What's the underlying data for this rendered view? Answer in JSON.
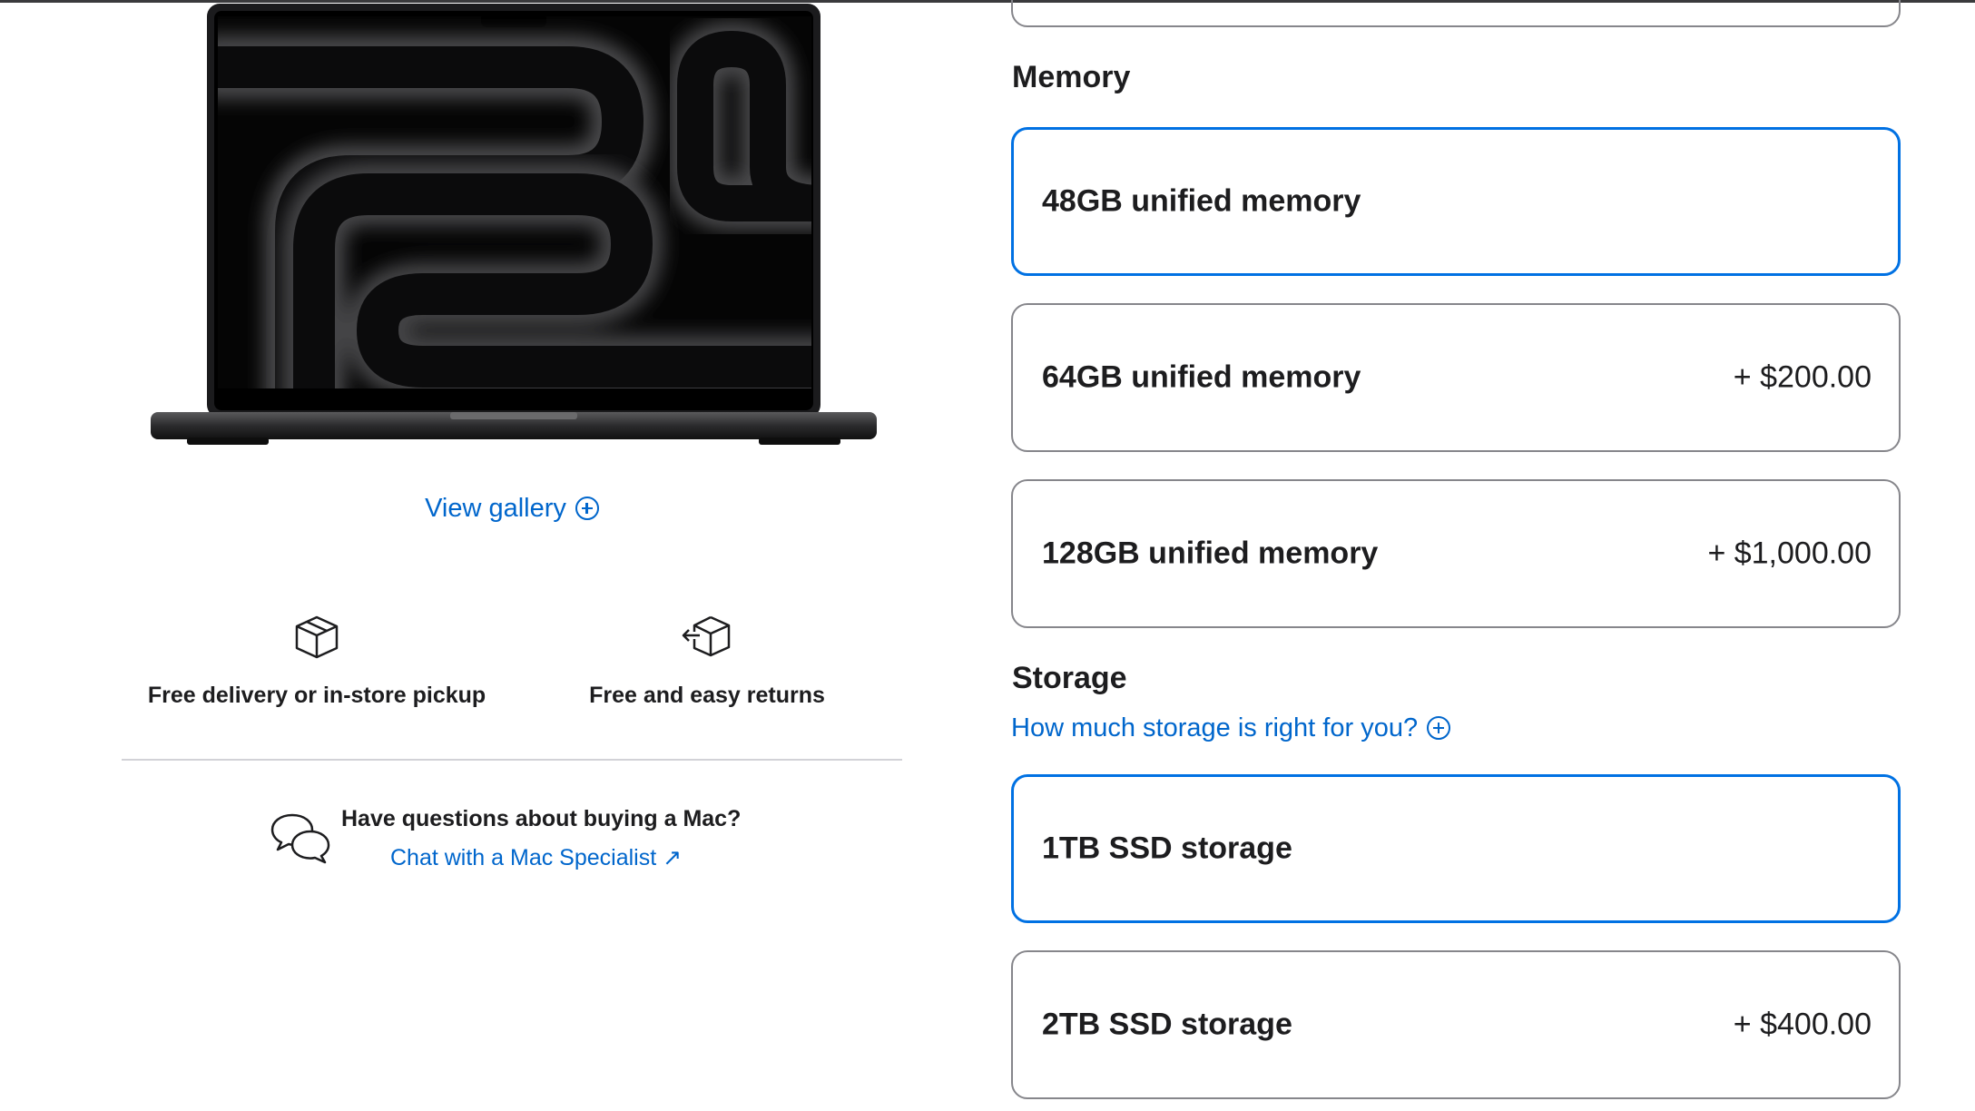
{
  "gallery": {
    "label": "View gallery"
  },
  "features": [
    {
      "icon": "package-icon",
      "label": "Free delivery or in-store pickup"
    },
    {
      "icon": "package-return-icon",
      "label": "Free and easy returns"
    }
  ],
  "chat": {
    "question": "Have questions about buying a Mac?",
    "link": "Chat with a Mac Specialist ↗"
  },
  "memory": {
    "title": "Memory",
    "options": [
      {
        "name": "48GB unified memory",
        "price": "",
        "selected": true
      },
      {
        "name": "64GB unified memory",
        "price": "+ $200.00",
        "selected": false
      },
      {
        "name": "128GB unified memory",
        "price": "+ $1,000.00",
        "selected": false
      }
    ]
  },
  "storage": {
    "title": "Storage",
    "help": "How much storage is right for you?",
    "options": [
      {
        "name": "1TB SSD storage",
        "price": "",
        "selected": true
      },
      {
        "name": "2TB SSD storage",
        "price": "+ $400.00",
        "selected": false
      }
    ]
  },
  "colors": {
    "accent": "#0071e3",
    "link": "#0066cc",
    "text": "#1d1d1f",
    "border": "#86868b"
  }
}
